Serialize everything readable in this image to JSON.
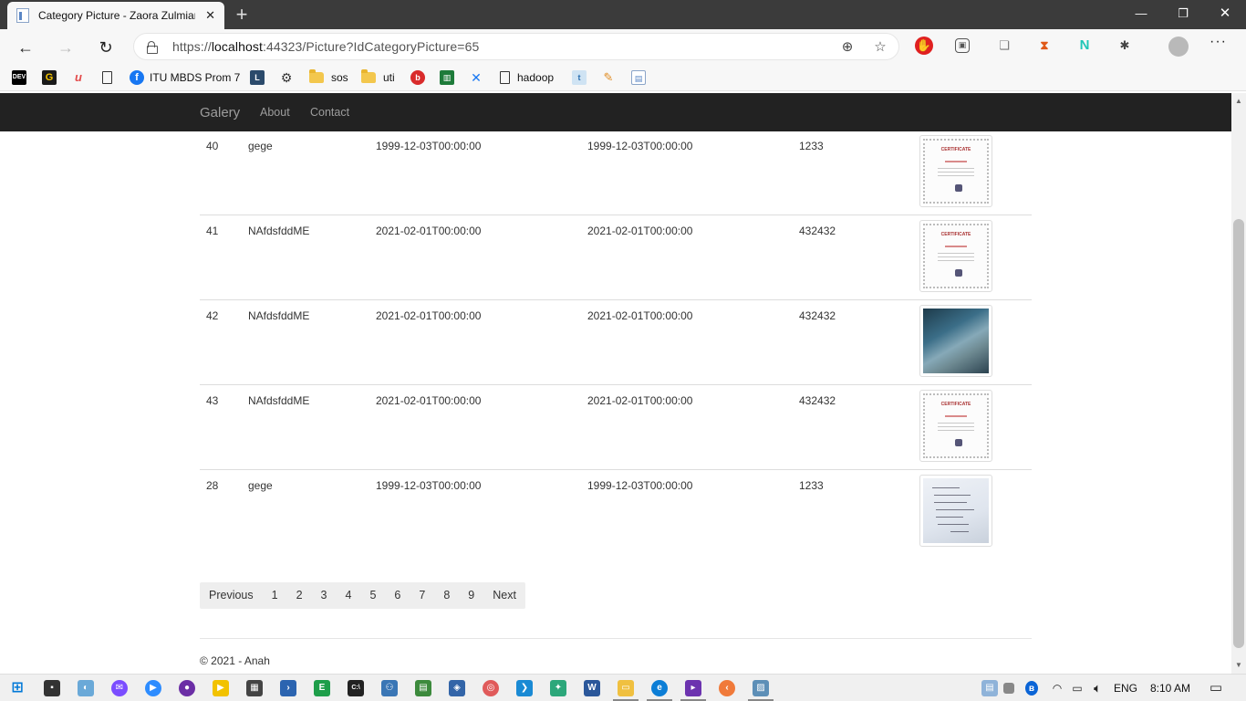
{
  "browser": {
    "tab_title": "Category Picture - Zaora Zulmiar",
    "url_prefix": "https://",
    "url_host": "localhost",
    "url_rest": ":44323/Picture?IdCategoryPicture=65",
    "bookmarks": [
      {
        "label": "",
        "icon": "dev-icon"
      },
      {
        "label": "",
        "icon": "g-icon"
      },
      {
        "label": "",
        "icon": "u-icon"
      },
      {
        "label": "",
        "icon": "page-icon"
      },
      {
        "label": "ITU MBDS Prom 7",
        "icon": "facebook-icon"
      },
      {
        "label": "",
        "icon": "l-icon"
      },
      {
        "label": "",
        "icon": "gear-icon"
      },
      {
        "label": "sos",
        "icon": "folder-icon"
      },
      {
        "label": "uti",
        "icon": "folder-icon"
      },
      {
        "label": "",
        "icon": "b-icon"
      },
      {
        "label": "",
        "icon": "chart-icon"
      },
      {
        "label": "",
        "icon": "x-icon"
      },
      {
        "label": "hadoop",
        "icon": "page-icon"
      },
      {
        "label": "",
        "icon": "t-icon"
      },
      {
        "label": "",
        "icon": "pencil-icon"
      },
      {
        "label": "",
        "icon": "doc-icon"
      }
    ]
  },
  "site": {
    "brand": "Galery",
    "nav": [
      "About",
      "Contact"
    ]
  },
  "rows": [
    {
      "id": "40",
      "name": "gege",
      "date1": "1999-12-03T00:00:00",
      "date2": "1999-12-03T00:00:00",
      "number": "1233",
      "image": "certificate"
    },
    {
      "id": "41",
      "name": "NAfdsfddME",
      "date1": "2021-02-01T00:00:00",
      "date2": "2021-02-01T00:00:00",
      "number": "432432",
      "image": "certificate"
    },
    {
      "id": "42",
      "name": "NAfdsfddME",
      "date1": "2021-02-01T00:00:00",
      "date2": "2021-02-01T00:00:00",
      "number": "432432",
      "image": "photo-screen"
    },
    {
      "id": "43",
      "name": "NAfdsfddME",
      "date1": "2021-02-01T00:00:00",
      "date2": "2021-02-01T00:00:00",
      "number": "432432",
      "image": "certificate"
    },
    {
      "id": "28",
      "name": "gege",
      "date1": "1999-12-03T00:00:00",
      "date2": "1999-12-03T00:00:00",
      "number": "1233",
      "image": "photo-notes"
    }
  ],
  "pager": {
    "previous": "Previous",
    "pages": [
      "1",
      "2",
      "3",
      "4",
      "5",
      "6",
      "7",
      "8",
      "9"
    ],
    "next": "Next"
  },
  "footer": "© 2021 - Anah",
  "taskbar": {
    "language": "ENG",
    "time": "8:10 AM"
  }
}
